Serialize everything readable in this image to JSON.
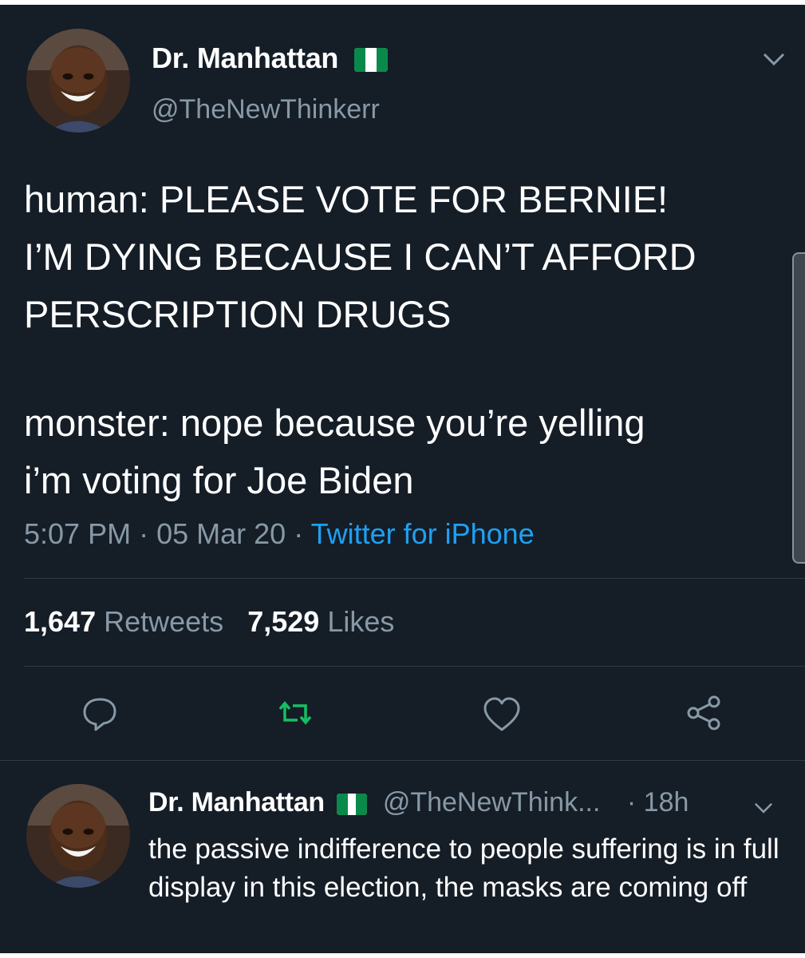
{
  "tweet": {
    "author_name": "Dr. Manhattan",
    "author_handle": "@TheNewThinkerr",
    "flag_icon": "nigeria-flag-icon",
    "text_part1": "human: PLEASE VOTE FOR BERNIE!\nI’M DYING BECAUSE I CAN’T AFFORD\nPERSCRIPTION DRUGS",
    "text_part2": "monster: nope because you’re yelling\ni’m voting for Joe Biden",
    "time": "5:07 PM",
    "date": "05 Mar 20",
    "separator": "·",
    "source": "Twitter for iPhone",
    "retweets_count": "1,647",
    "retweets_label": "Retweets",
    "likes_count": "7,529",
    "likes_label": "Likes"
  },
  "actions": {
    "reply_icon": "reply-icon",
    "retweet_icon": "retweet-icon",
    "like_icon": "heart-icon",
    "share_icon": "share-icon"
  },
  "reply": {
    "author_name": "Dr. Manhattan",
    "author_handle": "@TheNewThink...",
    "separator": "·",
    "time": "18h",
    "text": "the passive indifference to people suffering is in full display in this election, the masks are coming off"
  },
  "colors": {
    "background": "#151d27",
    "text": "#ffffff",
    "secondary": "#8899a6",
    "link": "#1da1f2",
    "retweet_green": "#17bf63"
  }
}
